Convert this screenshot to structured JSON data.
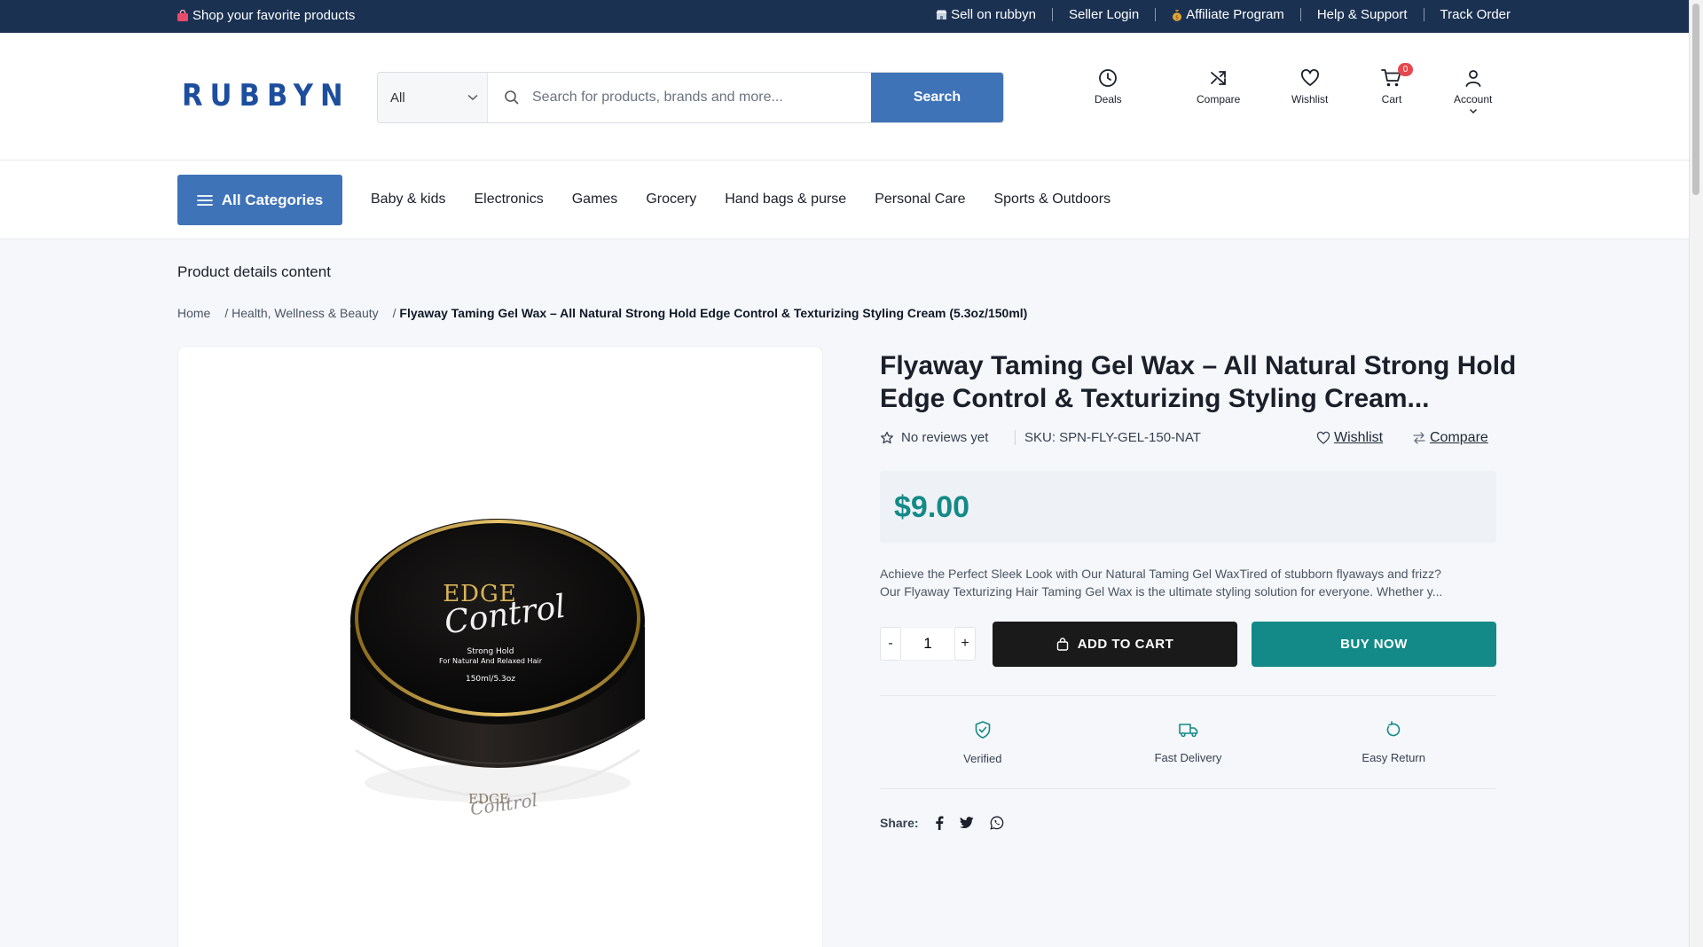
{
  "topbar": {
    "promo": "Shop your favorite products",
    "links": [
      {
        "label": "Sell on rubbyn",
        "icon": "store-icon"
      },
      {
        "label": "Seller Login",
        "icon": ""
      },
      {
        "label": "Affiliate Program",
        "icon": "money-bag-icon"
      },
      {
        "label": "Help & Support",
        "icon": ""
      },
      {
        "label": "Track Order",
        "icon": ""
      }
    ]
  },
  "header": {
    "logo": "RUBBYN",
    "search": {
      "category": "All",
      "placeholder": "Search for products, brands and more...",
      "button": "Search"
    },
    "icons": [
      {
        "label": "Deals",
        "icon": "clock-icon"
      },
      {
        "label": "Compare",
        "icon": "shuffle-icon"
      },
      {
        "label": "Wishlist",
        "icon": "heart-icon"
      },
      {
        "label": "Cart",
        "icon": "cart-icon",
        "badge": "0"
      },
      {
        "label": "Account",
        "icon": "user-icon"
      }
    ]
  },
  "nav": {
    "all_categories": "All Categories",
    "links": [
      "Baby & kids",
      "Electronics",
      "Games",
      "Grocery",
      "Hand bags & purse",
      "Personal Care",
      "Sports & Outdoors"
    ]
  },
  "page": {
    "title": "Product details content",
    "breadcrumb": {
      "home": "Home",
      "category": "Health, Wellness & Beauty",
      "current": "Flyaway Taming Gel Wax – All Natural Strong Hold Edge Control & Texturizing Styling Cream (5.3oz/150ml)"
    }
  },
  "product": {
    "title_line1": "Flyaway Taming Gel Wax – All Natural Strong Hold",
    "title_line2": "Edge Control & Texturizing Styling Cream...",
    "reviews": "No reviews yet",
    "sku": "SKU: SPN-FLY-GEL-150-NAT",
    "wishlist": "Wishlist",
    "compare": "Compare",
    "price": "$9.00",
    "description_line1": "Achieve the Perfect Sleek Look with Our Natural Taming Gel WaxTired of stubborn flyaways and frizz?",
    "description_line2": "Our Flyaway Texturizing Hair Taming Gel Wax is the ultimate styling solution for everyone. Whether y...",
    "qty_minus": "-",
    "qty_value": "1",
    "qty_plus": "+",
    "add_to_cart": "ADD TO CART",
    "buy_now": "BUY NOW",
    "features": [
      {
        "label": "Verified",
        "icon": "shield-check-icon"
      },
      {
        "label": "Fast Delivery",
        "icon": "truck-icon"
      },
      {
        "label": "Easy Return",
        "icon": "rotate-icon"
      }
    ],
    "share_label": "Share:",
    "share_icons": [
      "facebook-icon",
      "twitter-icon",
      "whatsapp-icon"
    ],
    "image_text": {
      "brand_top": "EDGE",
      "brand_script": "Control",
      "hold": "Strong Hold",
      "for": "For Natural And Relaxed Hair",
      "size": "150ml/5.3oz",
      "side_top": "EDGE",
      "side_script": "Control"
    }
  },
  "colors": {
    "topbar": "#1a3152",
    "primary": "#3f73b8",
    "price": "#138a87",
    "buy_now": "#138a87",
    "add_to_cart": "#1a1a1a",
    "badge": "#e5484d"
  }
}
